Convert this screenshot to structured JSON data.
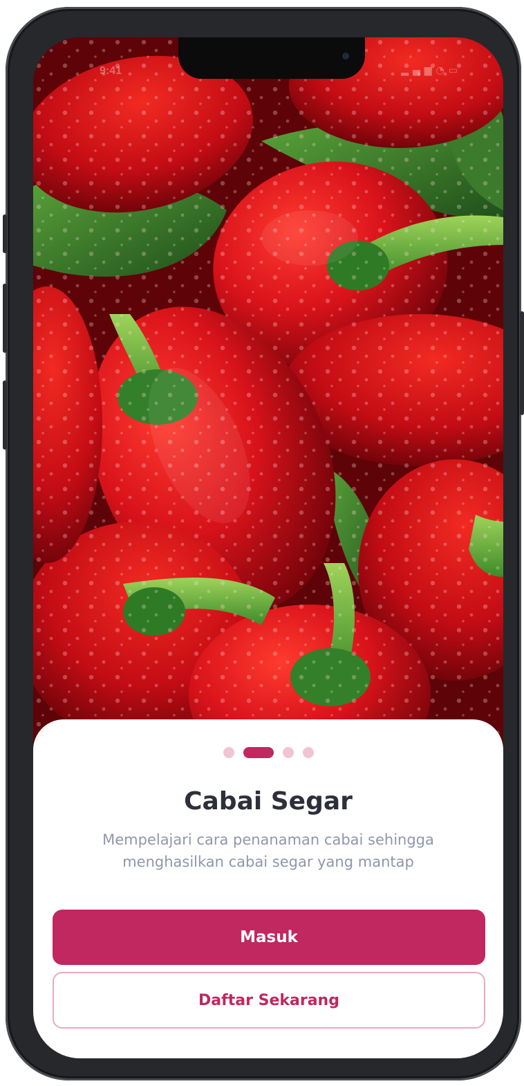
{
  "status_bar": {
    "time": "9:41",
    "icons": [
      "signal-icon",
      "wifi-icon",
      "battery-icon"
    ]
  },
  "hero": {
    "image": "red-chili-peppers-photo"
  },
  "onboarding": {
    "page_indicator": {
      "total": 4,
      "active_index": 1
    },
    "title": "Cabai Segar",
    "description": "Mempelajari cara penanaman cabai sehingga menghasilkan cabai segar yang mantap",
    "login_label": "Masuk",
    "register_label": "Daftar Sekarang"
  },
  "colors": {
    "accent": "#c0285f",
    "accent_light": "#f2c3d3",
    "title": "#2d2f3a",
    "body_text": "#8f96ad"
  }
}
